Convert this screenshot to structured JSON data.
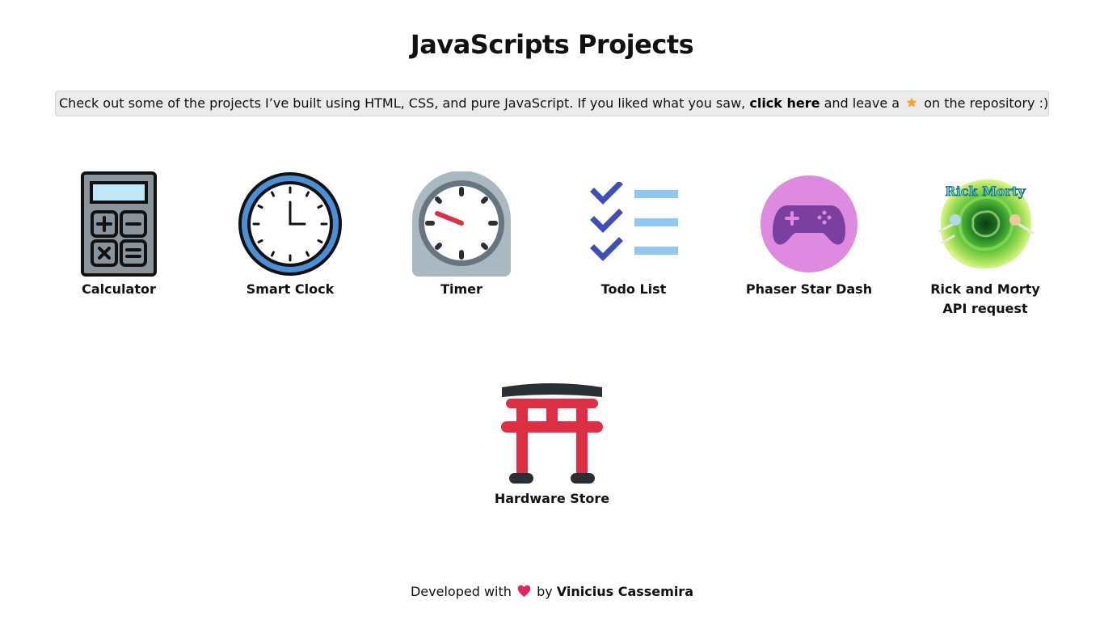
{
  "header": {
    "title": "JavaScripts Projects"
  },
  "banner": {
    "text_before": "Check out some of the projects I’ve built using HTML, CSS, and pure JavaScript. If you liked what you saw,",
    "link_text": "click here",
    "text_middle": "and leave a",
    "star_icon": "star-icon",
    "text_after": "on the repository :)"
  },
  "projects": [
    {
      "label": "Calculator",
      "icon": "calculator-icon"
    },
    {
      "label": "Smart Clock",
      "icon": "clock-icon"
    },
    {
      "label": "Timer",
      "icon": "timer-icon"
    },
    {
      "label": "Todo List",
      "icon": "checklist-icon"
    },
    {
      "label": "Phaser Star Dash",
      "icon": "gamepad-icon"
    },
    {
      "label_line1": "Rick and Morty",
      "label_line2": "API request",
      "icon": "rick-and-morty-portal-icon"
    },
    {
      "label": "Hardware Store",
      "icon": "torii-gate-icon"
    }
  ],
  "footer": {
    "text_before": "Developed with",
    "heart_icon": "heart-icon",
    "text_by": "by",
    "author": "Vinicius Cassemira"
  },
  "colors": {
    "banner_bg": "#ebebeb",
    "clock_ring": "#4a90d9",
    "gamepad_bg": "#dd8ae0",
    "gamepad": "#7b3fa0",
    "checkmark": "#3f4db8",
    "checklist_lines": "#90c8f5",
    "torii_red": "#dd2e44",
    "heart": "#e0245e",
    "star": "#f7a531"
  }
}
